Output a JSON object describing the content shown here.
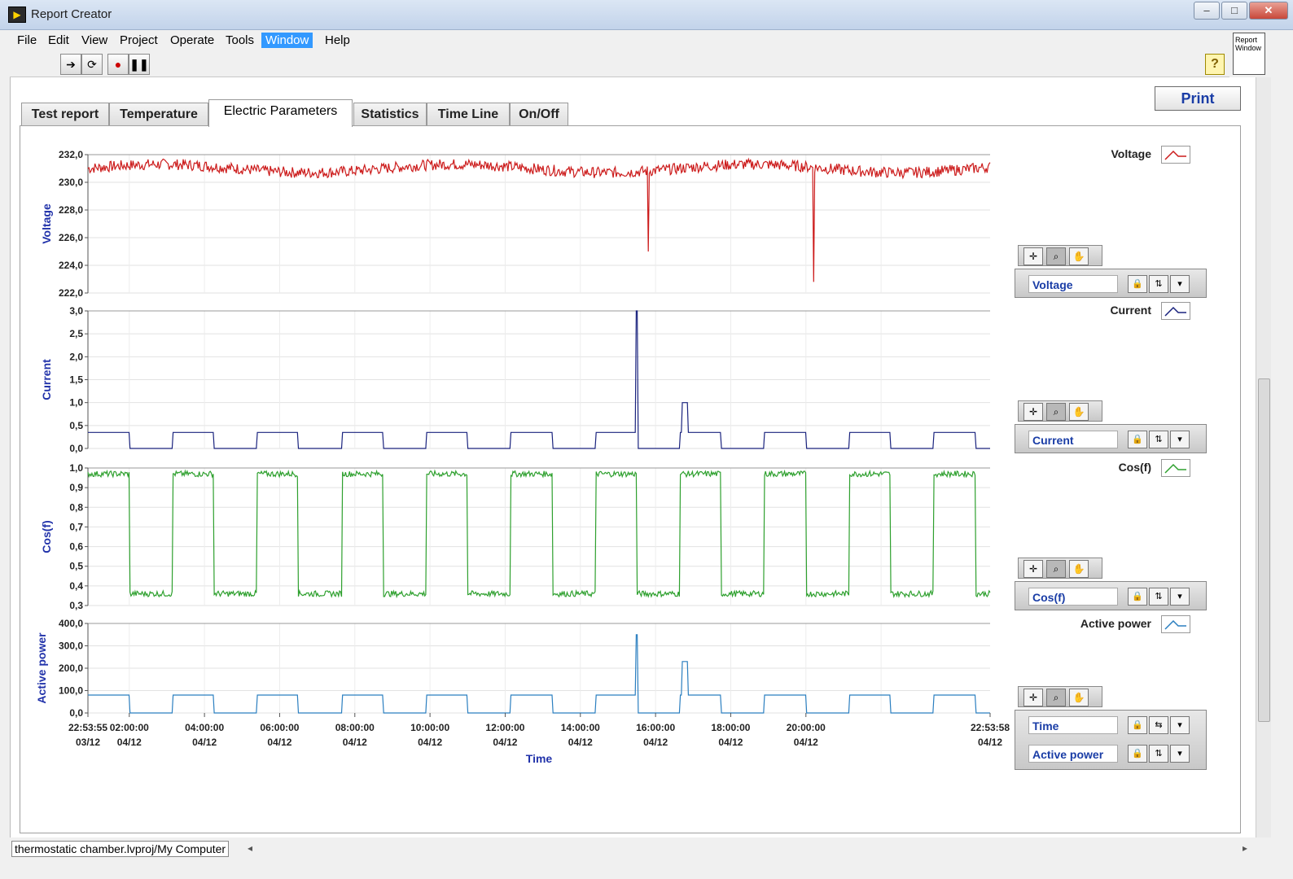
{
  "window": {
    "title": "Report Creator"
  },
  "menu": [
    "File",
    "Edit",
    "View",
    "Project",
    "Operate",
    "Tools",
    "Window",
    "Help"
  ],
  "menu_active": "Window",
  "report_window_icon": "Report Window",
  "print_label": "Print",
  "tabs": [
    "Test report",
    "Temperature",
    "Electric Parameters",
    "Statistics",
    "Time Line",
    "On/Off"
  ],
  "selected_tab": "Electric Parameters",
  "legend": [
    "Voltage",
    "Current",
    "Cos(f)",
    "Active power"
  ],
  "scales": {
    "voltage": "Voltage",
    "current": "Current",
    "cosf": "Cos(f)",
    "time": "Time",
    "power": "Active power"
  },
  "status_path": "thermostatic chamber.lvproj/My Computer",
  "colors": {
    "voltage": "#cc1b1b",
    "current": "#1a237e",
    "cosf": "#2ea02e",
    "power": "#2b7fc0",
    "accent": "#1a3da6"
  },
  "chart_data": [
    {
      "type": "line",
      "ylabel": "Voltage",
      "ylim": [
        222.0,
        232.0
      ],
      "yticks": [
        "232,0",
        "230,0",
        "228,0",
        "226,0",
        "224,0",
        "222,0"
      ],
      "series": [
        {
          "name": "Voltage",
          "baseline": 231.0,
          "dips": [
            [
              14.9,
              225.0
            ],
            [
              19.3,
              222.8
            ]
          ]
        }
      ]
    },
    {
      "type": "line",
      "ylabel": "Current",
      "ylim": [
        0.0,
        3.0
      ],
      "yticks": [
        "3,0",
        "2,5",
        "2,0",
        "1,5",
        "1,0",
        "0,5",
        "0,0"
      ],
      "series": [
        {
          "name": "Current",
          "on_level": 0.35,
          "off_level": 0.0,
          "spike": [
            14.6,
            3.0
          ],
          "bump": [
            15.8,
            1.0
          ]
        }
      ]
    },
    {
      "type": "line",
      "ylabel": "Cos(f)",
      "ylim": [
        0.3,
        1.0
      ],
      "yticks": [
        "1,0",
        "0,9",
        "0,8",
        "0,7",
        "0,6",
        "0,5",
        "0,4",
        "0,3"
      ],
      "series": [
        {
          "name": "Cos(f)",
          "on_level": 0.97,
          "off_level": 0.36
        }
      ]
    },
    {
      "type": "line",
      "ylabel": "Active power",
      "xlabel": "Time",
      "ylim": [
        0.0,
        400.0
      ],
      "yticks": [
        "400,0",
        "300,0",
        "200,0",
        "100,0",
        "0,0"
      ],
      "series": [
        {
          "name": "Active power",
          "on_level": 80,
          "off_level": 0,
          "spike": [
            14.6,
            350
          ],
          "bump": [
            15.8,
            230
          ]
        }
      ],
      "xticks": [
        [
          "22:53:55",
          "03/12"
        ],
        [
          "02:00:00",
          "04/12"
        ],
        [
          "04:00:00",
          "04/12"
        ],
        [
          "06:00:00",
          "04/12"
        ],
        [
          "08:00:00",
          "04/12"
        ],
        [
          "10:00:00",
          "04/12"
        ],
        [
          "12:00:00",
          "04/12"
        ],
        [
          "14:00:00",
          "04/12"
        ],
        [
          "16:00:00",
          "04/12"
        ],
        [
          "18:00:00",
          "04/12"
        ],
        [
          "20:00:00",
          "04/12"
        ],
        [
          "22:53:58",
          "04/12"
        ]
      ]
    }
  ]
}
